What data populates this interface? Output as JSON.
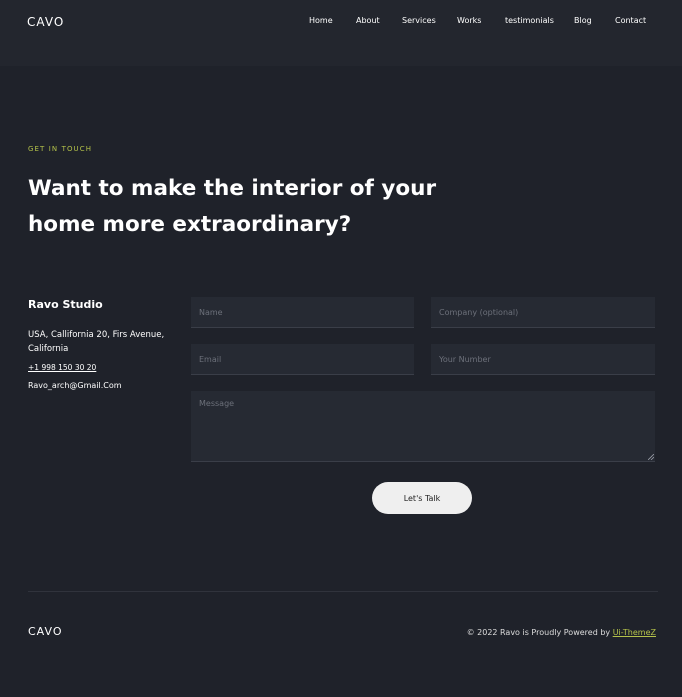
{
  "brand": {
    "logo": "CAVO"
  },
  "nav": {
    "items": [
      "Home",
      "About",
      "Services",
      "Works",
      "testimonials",
      "Blog",
      "Contact"
    ]
  },
  "hero": {
    "eyebrow": "GET IN TOUCH",
    "headline_line1": "Want to make the interior of your",
    "headline_line2": "home more extraordinary?"
  },
  "contact_info": {
    "studio": "Ravo Studio",
    "address": "USA, Callifornia 20, Firs Avenue, California",
    "phone": "+1 998 150 30 20",
    "email": "Ravo_arch@Gmail.Com"
  },
  "form": {
    "name_placeholder": "Name",
    "company_placeholder": "Company (optional)",
    "email_placeholder": "Email",
    "number_placeholder": "Your Number",
    "message_placeholder": "Message",
    "submit_label": "Let's Talk"
  },
  "footer": {
    "logo": "CAVO",
    "copyright": "© 2022 Ravo is Proudly Powered by",
    "link_label": "Ui-ThemeZ"
  },
  "colors": {
    "accent": "#b4c24a",
    "background": "#1f222a",
    "nav_bg": "#23262e",
    "field_bg": "#262a33"
  }
}
